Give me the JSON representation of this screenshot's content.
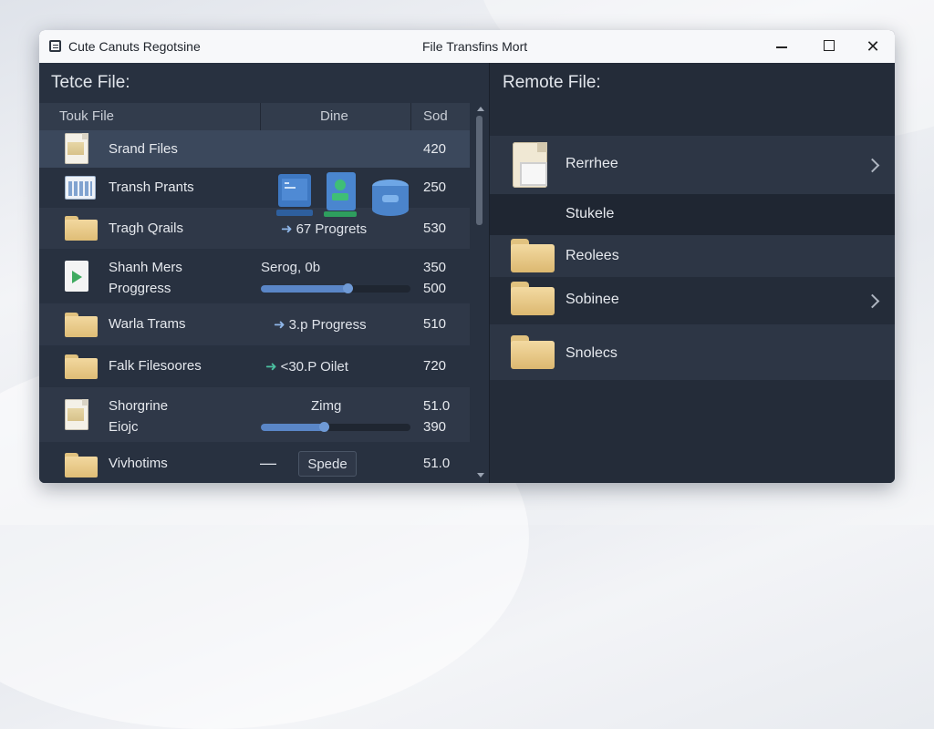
{
  "window": {
    "app_name": "Cute Canuts Regotsine",
    "title": "File Transfins Mort"
  },
  "left_pane": {
    "title": "Tetce File:",
    "columns": [
      "Touk File",
      "Dine",
      "Sod"
    ],
    "rows": [
      {
        "name": "Srand Files",
        "status": "",
        "size": "420",
        "icon": "document-icon",
        "selected": true
      },
      {
        "name": "Transh Prants",
        "status": "",
        "size": "250",
        "icon": "calendar-icon"
      },
      {
        "name": "Tragh Qrails",
        "status": "67 Progrets",
        "status_arrow": "➜",
        "size": "530",
        "icon": "folder-icon"
      },
      {
        "name": "Shanh Mers",
        "name2": "Proggress",
        "status": "Serog, 0b",
        "size": "350",
        "size2": "500",
        "icon": "video-file-icon",
        "progress": 0.62
      },
      {
        "name": "Warla Trams",
        "status": "3.p Progress",
        "status_arrow": "➜",
        "size": "510",
        "icon": "folder-icon"
      },
      {
        "name": "Falk Filesoores",
        "status": "<30.P Oilet",
        "status_arrow": "➜",
        "size": "720",
        "icon": "folder-icon"
      },
      {
        "name": "Shorgrine",
        "name2": "Eiojc",
        "status": "Zimg",
        "size": "51.0",
        "size2": "390",
        "icon": "document-icon",
        "progress": 0.42
      },
      {
        "name": "Vivhotims",
        "minus": "—",
        "spin_label": "Spede",
        "size": "51.0",
        "icon": "folder-icon"
      }
    ]
  },
  "right_pane": {
    "title": "Remote File:",
    "items": [
      {
        "name": "Rerrhee",
        "icon": "document-icon",
        "has_chevron": true
      },
      {
        "name": "Stukele"
      },
      {
        "name": "Reolees",
        "icon": "folder-icon"
      },
      {
        "name": "Sobinee",
        "icon": "folder-icon",
        "has_chevron": true
      },
      {
        "name": "Snolecs",
        "icon": "folder-icon"
      }
    ]
  },
  "colors": {
    "pane_bg": "#283140",
    "selected_row": "#3b485c",
    "progress_fill": "#5a86c7",
    "folder": "#f2d89f",
    "titlebar": "#f7f8fa"
  }
}
